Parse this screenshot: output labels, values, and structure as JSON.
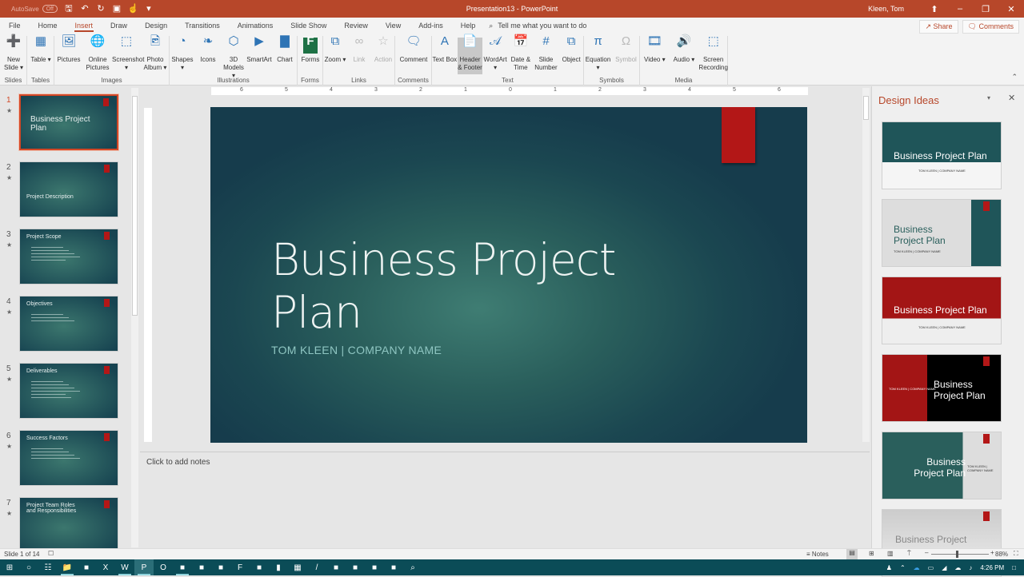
{
  "window": {
    "title": "Presentation13 - PowerPoint",
    "user": "Kleen, Tom",
    "autosave_label": "AutoSave",
    "autosave_state": "Off"
  },
  "tabs": [
    "File",
    "Home",
    "Insert",
    "Draw",
    "Design",
    "Transitions",
    "Animations",
    "Slide Show",
    "Review",
    "View",
    "Add-ins",
    "Help"
  ],
  "active_tab": "Insert",
  "tell_me": "Tell me what you want to do",
  "share_label": "Share",
  "comments_label": "Comments",
  "ribbon": {
    "groups": [
      {
        "label": "Slides",
        "buttons": [
          {
            "label": "New Slide",
            "sub": "▾",
            "icon": "new-slide-icon"
          }
        ]
      },
      {
        "label": "Tables",
        "buttons": [
          {
            "label": "Table",
            "sub": "▾",
            "icon": "table-icon"
          }
        ]
      },
      {
        "label": "Images",
        "buttons": [
          {
            "label": "Pictures",
            "icon": "pictures-icon"
          },
          {
            "label": "Online Pictures",
            "icon": "online-pictures-icon"
          },
          {
            "label": "Screenshot",
            "sub": "▾",
            "icon": "screenshot-icon"
          },
          {
            "label": "Photo Album",
            "sub": "▾",
            "icon": "photo-album-icon"
          }
        ]
      },
      {
        "label": "Illustrations",
        "buttons": [
          {
            "label": "Shapes",
            "sub": "▾",
            "icon": "shapes-icon"
          },
          {
            "label": "Icons",
            "icon": "icons-icon"
          },
          {
            "label": "3D Models",
            "sub": "▾",
            "icon": "3d-models-icon"
          },
          {
            "label": "SmartArt",
            "icon": "smartart-icon"
          },
          {
            "label": "Chart",
            "icon": "chart-icon"
          }
        ]
      },
      {
        "label": "Forms",
        "buttons": [
          {
            "label": "Forms",
            "icon": "forms-icon"
          }
        ]
      },
      {
        "label": "Links",
        "buttons": [
          {
            "label": "Zoom",
            "sub": "▾",
            "icon": "zoom-icon"
          },
          {
            "label": "Link",
            "disabled": true,
            "icon": "link-icon"
          },
          {
            "label": "Action",
            "disabled": true,
            "icon": "action-icon"
          }
        ]
      },
      {
        "label": "Comments",
        "buttons": [
          {
            "label": "Comment",
            "icon": "comment-icon"
          }
        ]
      },
      {
        "label": "Text",
        "buttons": [
          {
            "label": "Text Box",
            "icon": "text-box-icon"
          },
          {
            "label": "Header & Footer",
            "icon": "header-footer-icon",
            "hover": true
          },
          {
            "label": "WordArt",
            "sub": "▾",
            "icon": "wordart-icon"
          },
          {
            "label": "Date & Time",
            "icon": "date-time-icon"
          },
          {
            "label": "Slide Number",
            "icon": "slide-number-icon"
          },
          {
            "label": "Object",
            "icon": "object-icon"
          }
        ]
      },
      {
        "label": "Symbols",
        "buttons": [
          {
            "label": "Equation",
            "sub": "▾",
            "icon": "equation-icon"
          },
          {
            "label": "Symbol",
            "disabled": true,
            "icon": "symbol-icon"
          }
        ]
      },
      {
        "label": "Media",
        "buttons": [
          {
            "label": "Video",
            "sub": "▾",
            "icon": "video-icon"
          },
          {
            "label": "Audio",
            "sub": "▾",
            "icon": "audio-icon"
          },
          {
            "label": "Screen Recording",
            "icon": "screen-recording-icon"
          }
        ]
      }
    ]
  },
  "thumbnails": [
    {
      "num": "1",
      "title": "Business Project Plan",
      "selected": true
    },
    {
      "num": "2",
      "title": "Project Description"
    },
    {
      "num": "3",
      "title": "Project Scope"
    },
    {
      "num": "4",
      "title": "Objectives"
    },
    {
      "num": "5",
      "title": "Deliverables"
    },
    {
      "num": "6",
      "title": "Success Factors"
    },
    {
      "num": "7",
      "title": "Project Team Roles and Responsibilities"
    }
  ],
  "ruler_labels": [
    "6",
    "5",
    "4",
    "3",
    "2",
    "1",
    "0",
    "1",
    "2",
    "3",
    "4",
    "5",
    "6"
  ],
  "slide": {
    "title_line1": "Business Project",
    "title_line2": "Plan",
    "subtitle": "TOM KLEEN | COMPANY NAME"
  },
  "notes_placeholder": "Click to add notes",
  "design_ideas": {
    "header": "Design Ideas",
    "items": [
      {
        "style": "teal-banner",
        "title": "Business Project Plan",
        "sub": "TOM KLEEN | COMPANY NAME"
      },
      {
        "style": "gray-teal",
        "title": "Business Project Plan",
        "sub": "TOM KLEEN | COMPANY NAME"
      },
      {
        "style": "red-banner",
        "title": "Business Project Plan",
        "sub": "TOM KLEEN | COMPANY NAME"
      },
      {
        "style": "red-black",
        "title": "Business Project Plan",
        "sub": "TOM KLEEN | COMPANY NAME"
      },
      {
        "style": "teal-gray",
        "title": "Business Project Plan",
        "sub": "TOM KLEEN | COMPANY NAME"
      },
      {
        "style": "silver",
        "title": "Business Project"
      }
    ]
  },
  "status": {
    "slide_info": "Slide 1 of 14",
    "notes_label": "Notes",
    "zoom_percent": "88%",
    "zoom_value": 88
  },
  "taskbar": {
    "time": "4:26 PM",
    "apps": [
      "start",
      "cortana",
      "task-view",
      "file-explorer",
      "app",
      "excel",
      "word",
      "powerpoint",
      "opera",
      "app",
      "app",
      "app",
      "filezilla",
      "app",
      "terminal",
      "calculator",
      "pen",
      "app",
      "app",
      "app",
      "app",
      "search"
    ]
  },
  "colors": {
    "accent": "#b7472a",
    "slide_red": "#b31717",
    "slide_teal": "#2a5f5c",
    "taskbar": "#0b4c57"
  }
}
